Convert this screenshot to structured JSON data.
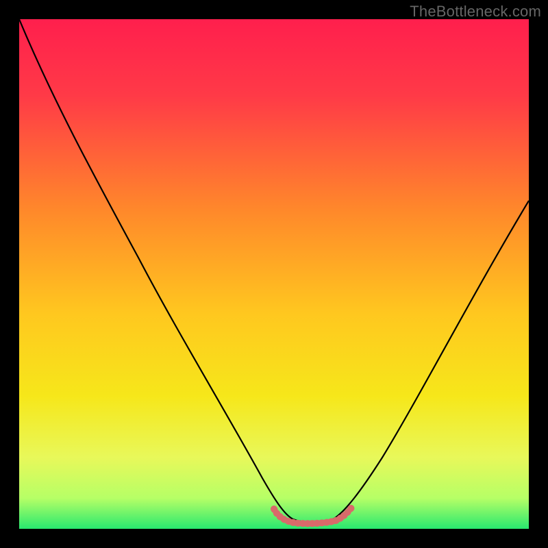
{
  "watermark": "TheBottleneck.com",
  "chart_data": {
    "type": "line",
    "title": "",
    "xlabel": "",
    "ylabel": "",
    "xlim": [
      0,
      1
    ],
    "ylim": [
      0,
      1
    ],
    "grid": false,
    "series": [
      {
        "name": "bottleneck-curve",
        "color": "#000000",
        "x": [
          0.0,
          0.07,
          0.14,
          0.21,
          0.28,
          0.35,
          0.42,
          0.49,
          0.52,
          0.56,
          0.6,
          0.63,
          0.66,
          0.72,
          0.8,
          0.88,
          0.96,
          1.0
        ],
        "y": [
          1.0,
          0.88,
          0.75,
          0.61,
          0.47,
          0.33,
          0.2,
          0.07,
          0.03,
          0.01,
          0.01,
          0.02,
          0.05,
          0.15,
          0.3,
          0.44,
          0.58,
          0.65
        ]
      },
      {
        "name": "optimal-band-marker",
        "color": "#d86a6a",
        "x": [
          0.51,
          0.53,
          0.55,
          0.57,
          0.59,
          0.61,
          0.63
        ],
        "y": [
          0.03,
          0.015,
          0.01,
          0.01,
          0.01,
          0.015,
          0.03
        ]
      }
    ],
    "background_gradient_stops": [
      {
        "offset": 0.0,
        "color": "#ff1f4d"
      },
      {
        "offset": 0.15,
        "color": "#ff3a47"
      },
      {
        "offset": 0.38,
        "color": "#ff8a2a"
      },
      {
        "offset": 0.58,
        "color": "#ffc81f"
      },
      {
        "offset": 0.74,
        "color": "#f6e71a"
      },
      {
        "offset": 0.86,
        "color": "#e8f85a"
      },
      {
        "offset": 0.94,
        "color": "#b6ff66"
      },
      {
        "offset": 1.0,
        "color": "#28e86f"
      }
    ]
  }
}
